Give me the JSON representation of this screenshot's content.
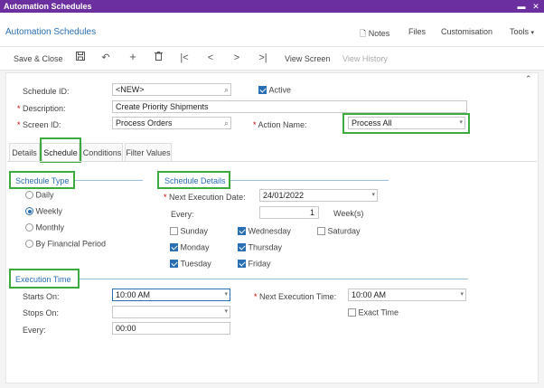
{
  "window": {
    "title": "Automation Schedules"
  },
  "header": {
    "screen_title": "Automation Schedules",
    "notes": "Notes",
    "files": "Files",
    "customisation": "Customisation",
    "tools": "Tools"
  },
  "toolbar": {
    "save_close": "Save & Close",
    "view_screen": "View Screen",
    "view_history": "View History"
  },
  "form": {
    "schedule_id_label": "Schedule ID:",
    "schedule_id_value": "<NEW>",
    "active_label": "Active",
    "active_checked": true,
    "description_label": "Description:",
    "description_value": "Create Priority Shipments",
    "screen_id_label": "Screen ID:",
    "screen_id_value": "Process Orders",
    "action_name_label": "Action Name:",
    "action_name_value": "Process All"
  },
  "tabs": [
    {
      "label": "Details",
      "active": false
    },
    {
      "label": "Schedule",
      "active": true
    },
    {
      "label": "Conditions",
      "active": false
    },
    {
      "label": "Filter Values",
      "active": false
    }
  ],
  "schedule_type": {
    "title": "Schedule Type",
    "options": [
      {
        "label": "Daily",
        "selected": false
      },
      {
        "label": "Weekly",
        "selected": true
      },
      {
        "label": "Monthly",
        "selected": false
      },
      {
        "label": "By Financial Period",
        "selected": false
      }
    ]
  },
  "schedule_details": {
    "title": "Schedule Details",
    "next_exec_date_label": "Next Execution Date:",
    "next_exec_date_value": "24/01/2022",
    "every_label": "Every:",
    "every_value": "1",
    "every_unit": "Week(s)",
    "days": [
      {
        "label": "Sunday",
        "checked": false
      },
      {
        "label": "Monday",
        "checked": true
      },
      {
        "label": "Tuesday",
        "checked": true
      },
      {
        "label": "Wednesday",
        "checked": true
      },
      {
        "label": "Thursday",
        "checked": true
      },
      {
        "label": "Friday",
        "checked": true
      },
      {
        "label": "Saturday",
        "checked": false
      }
    ]
  },
  "execution_time": {
    "title": "Execution Time",
    "starts_on_label": "Starts On:",
    "starts_on_value": "10:00 AM",
    "stops_on_label": "Stops On:",
    "stops_on_value": "",
    "every_label": "Every:",
    "every_value": "00:00",
    "next_exec_time_label": "Next Execution Time:",
    "next_exec_time_value": "10:00 AM",
    "exact_time_label": "Exact Time",
    "exact_time_checked": false
  },
  "colors": {
    "titlebar": "#6b2fa0",
    "accent": "#2a6fb4",
    "highlight": "#3caa3c"
  }
}
